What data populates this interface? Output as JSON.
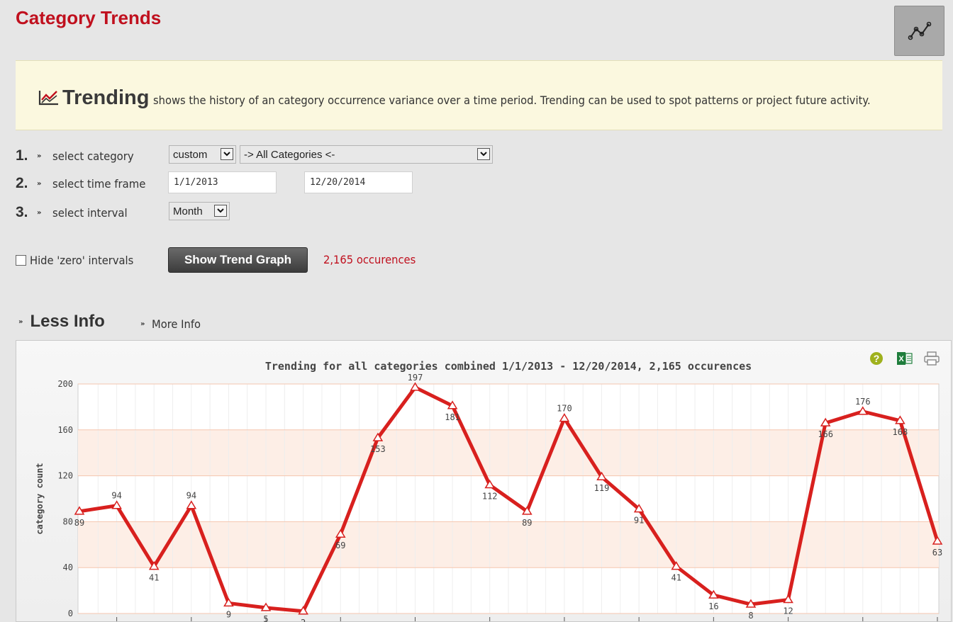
{
  "header": {
    "title": "Category Trends"
  },
  "info": {
    "strong": "Trending",
    "text": "shows the history of an category occurrence variance over a time period. Trending can be used to spot patterns or project future activity."
  },
  "steps": [
    {
      "num": "1.",
      "label": "select category"
    },
    {
      "num": "2.",
      "label": "select time frame"
    },
    {
      "num": "3.",
      "label": "select interval"
    }
  ],
  "filters": {
    "category_mode": "custom",
    "category": "-> All Categories <-",
    "date_from": "1/1/2013",
    "date_to": "12/20/2014",
    "interval": "Month"
  },
  "options": {
    "hide_zero_label": "Hide 'zero' intervals",
    "hide_zero_checked": false,
    "show_button": "Show Trend Graph",
    "occurrences": "2,165 occurences"
  },
  "info_toggle": {
    "less": "Less Info",
    "more": "More Info"
  },
  "colors": {
    "accent": "#c0101e",
    "line": "#d8201e",
    "band": "#fdeee6"
  },
  "chart_data": {
    "type": "line",
    "title": "Trending for all categories combined 1/1/2013 - 12/20/2014, 2,165 occurences",
    "ylabel": "category count",
    "xlabel": "",
    "ylim": [
      0,
      200
    ],
    "yticks": [
      "0",
      "40",
      "80",
      "120",
      "160",
      "200"
    ],
    "grid": true,
    "series": [
      {
        "values": [
          89,
          94,
          41,
          94,
          9,
          5,
          2,
          69,
          153,
          197,
          181,
          112,
          89,
          170,
          119,
          91,
          41,
          16,
          8,
          12,
          166,
          176,
          168,
          63
        ],
        "labels": [
          "89",
          "94",
          "41",
          "94",
          "9",
          "5",
          "2",
          "69",
          "153",
          "197",
          "181",
          "112",
          "89",
          "170",
          "119",
          "91",
          "41",
          "16",
          "8",
          "12",
          "166",
          "176",
          "168",
          "63"
        ]
      }
    ]
  },
  "icons": {
    "help": "help-icon",
    "excel": "excel-icon",
    "print": "print-icon",
    "trend": "trend-chart-icon"
  }
}
